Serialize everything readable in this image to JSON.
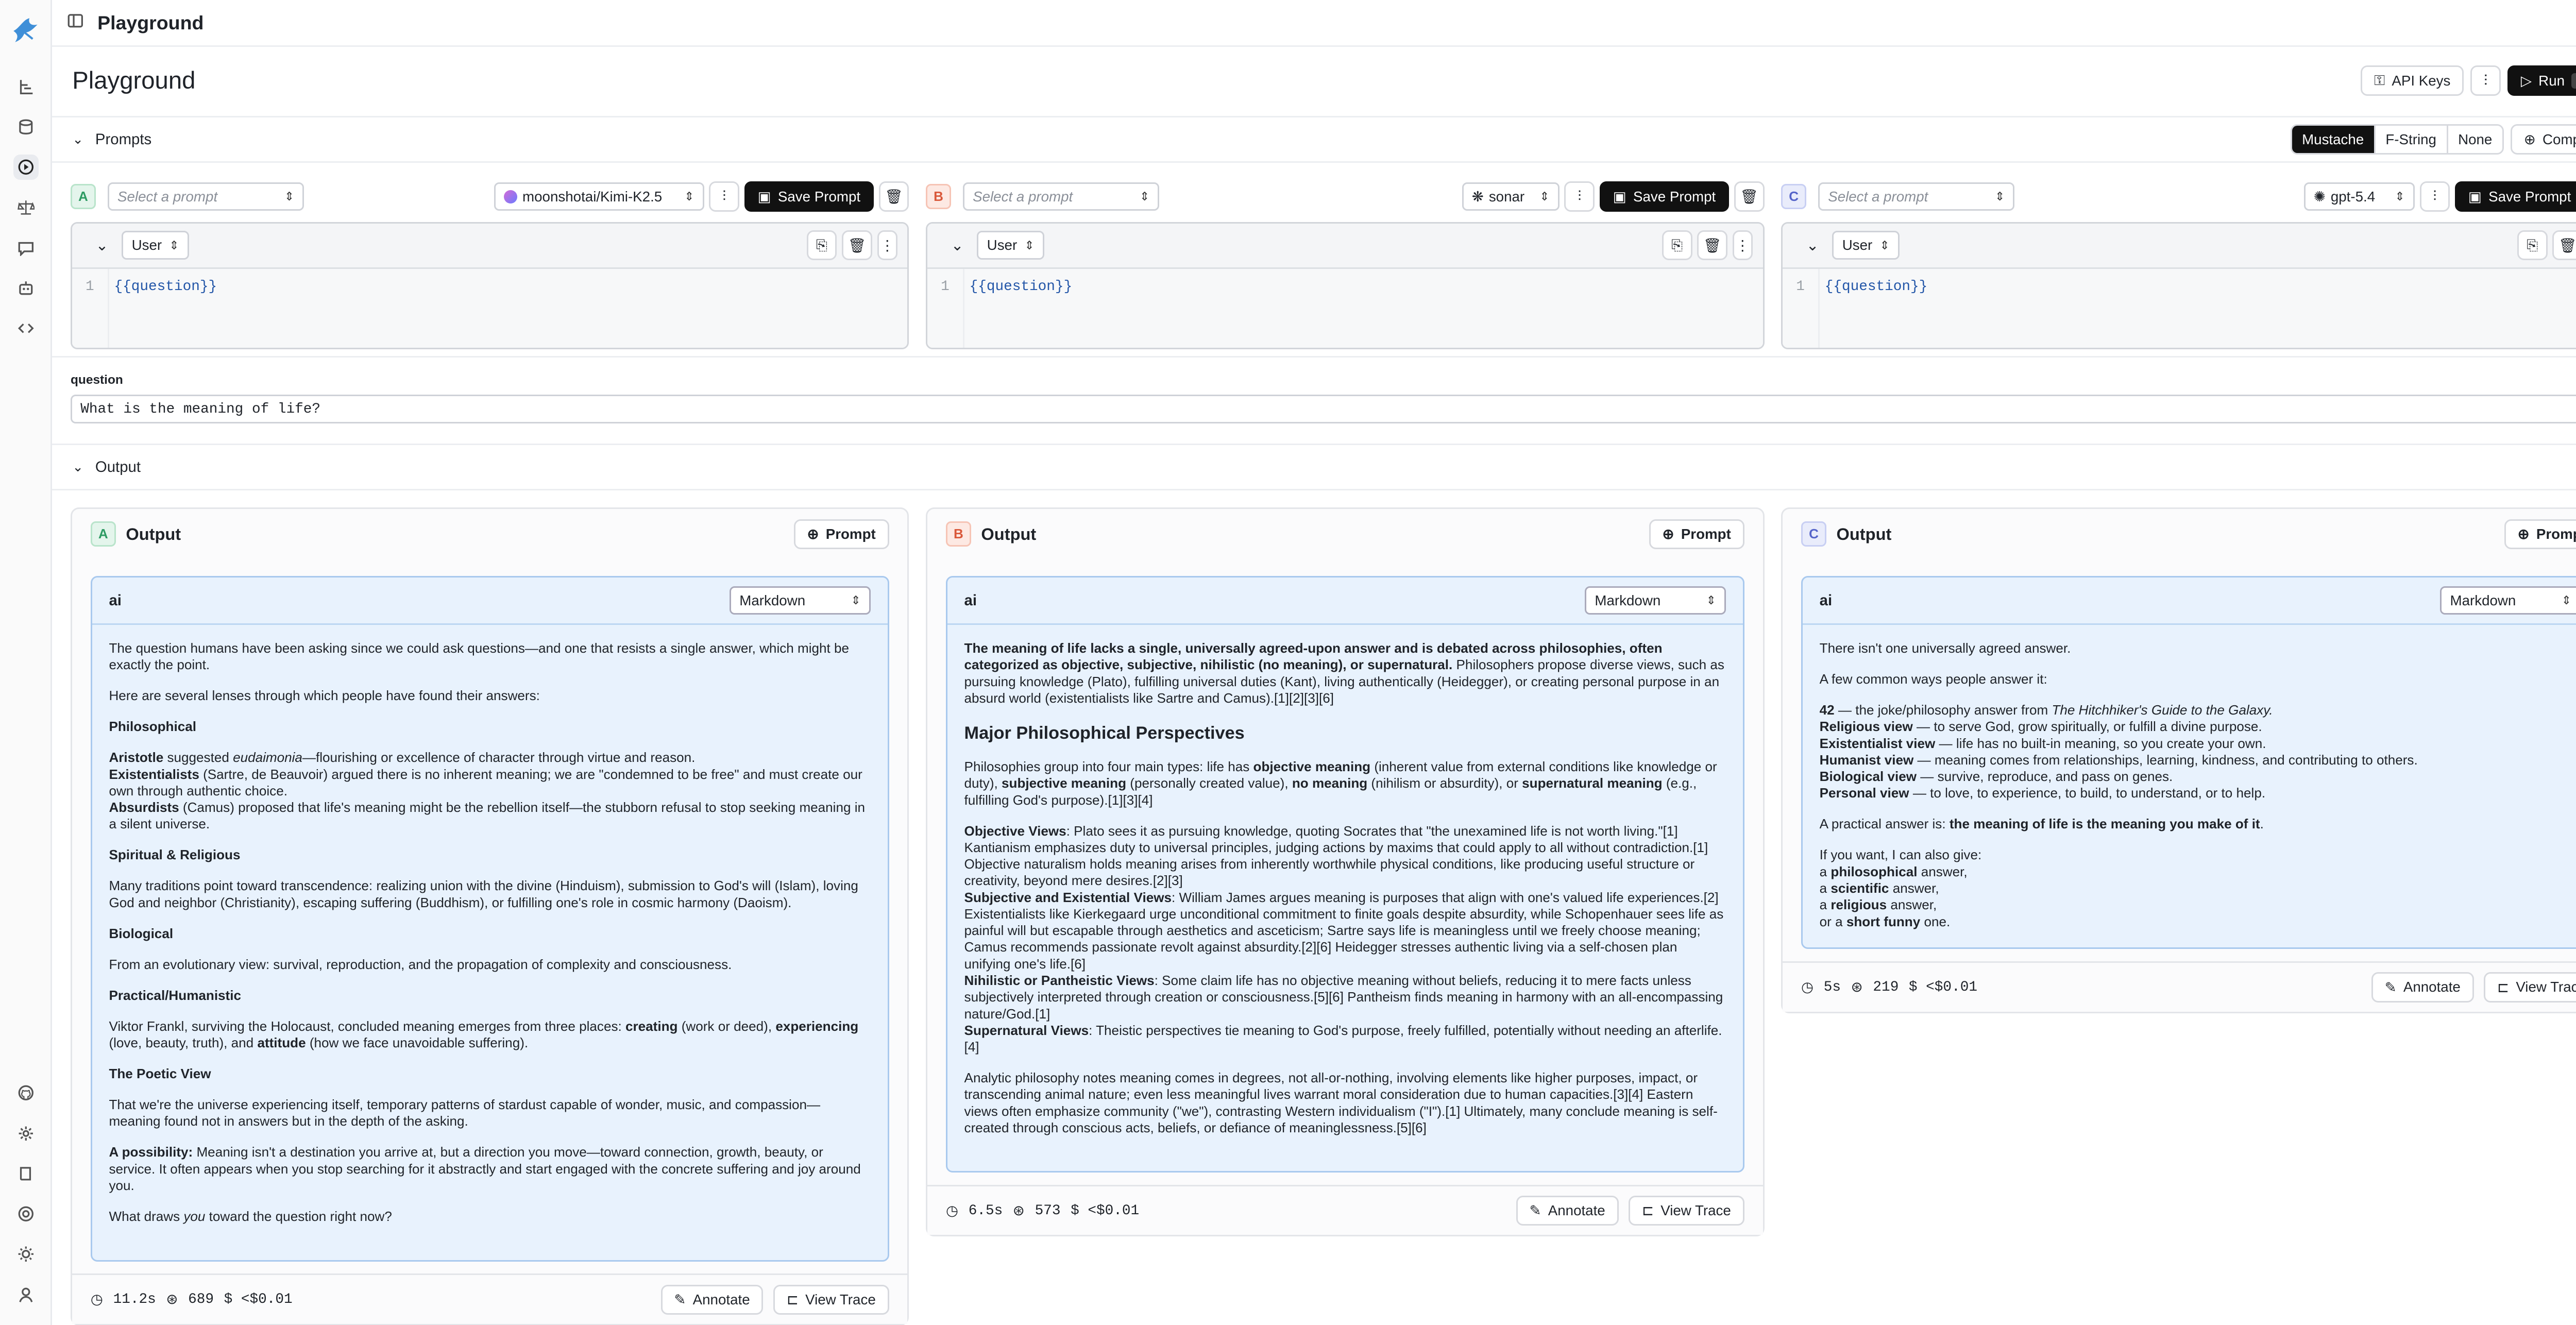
{
  "topbar": {
    "title": "Playground"
  },
  "header": {
    "title": "Playground",
    "api_keys": "API Keys",
    "run": "Run",
    "run_kbd": "⌘⏎"
  },
  "prompts_section": {
    "label": "Prompts",
    "formats": [
      "Mustache",
      "F-String",
      "None"
    ],
    "active_format": "Mustache",
    "compare": "Compare"
  },
  "panels": [
    {
      "letter": "A",
      "select_placeholder": "Select a prompt",
      "model": "moonshotai/Kimi-K2.5",
      "save": "Save Prompt",
      "role": "User",
      "line_no": "1",
      "template": "{{question}}"
    },
    {
      "letter": "B",
      "select_placeholder": "Select a prompt",
      "model": "sonar",
      "save": "Save Prompt",
      "role": "User",
      "line_no": "1",
      "template": "{{question}}"
    },
    {
      "letter": "C",
      "select_placeholder": "Select a prompt",
      "model": "gpt-5.4",
      "save": "Save Prompt",
      "role": "User",
      "line_no": "1",
      "template": "{{question}}"
    }
  ],
  "variables": {
    "label": "question",
    "value": "What is the meaning of life?"
  },
  "output_section": {
    "label": "Output"
  },
  "outputs": [
    {
      "letter": "A",
      "title": "Output",
      "prompt_btn": "Prompt",
      "role": "ai",
      "format": "Markdown",
      "time": "11.2s",
      "tokens": "689",
      "cost": "$ <$0.01",
      "annotate": "Annotate",
      "view_trace": "View Trace"
    },
    {
      "letter": "B",
      "title": "Output",
      "prompt_btn": "Prompt",
      "role": "ai",
      "format": "Markdown",
      "time": "6.5s",
      "tokens": "573",
      "cost": "$ <$0.01",
      "annotate": "Annotate",
      "view_trace": "View Trace"
    },
    {
      "letter": "C",
      "title": "Output",
      "prompt_btn": "Prompt",
      "role": "ai",
      "format": "Markdown",
      "time": "5s",
      "tokens": "219",
      "cost": "$ <$0.01",
      "annotate": "Annotate",
      "view_trace": "View Trace"
    }
  ],
  "text_a": {
    "p1": "The question humans have been asking since we could ask questions—and one that resists a single answer, which might be exactly the point.",
    "p2": "Here are several lenses through which people have found their answers:",
    "h_phil": "Philosophical",
    "aristotle_b": "Aristotle",
    "aristotle_t1": " suggested ",
    "aristotle_i": "eudaimonia",
    "aristotle_t2": "—flourishing or excellence of character through virtue and reason.",
    "exist_b": "Existentialists",
    "exist_t": " (Sartre, de Beauvoir) argued there is no inherent meaning; we are \"condemned to be free\" and must create our own through authentic choice.",
    "absurd_b": "Absurdists",
    "absurd_t": " (Camus) proposed that life's meaning might be the rebellion itself—the stubborn refusal to stop seeking meaning in a silent universe.",
    "h_spirit": "Spiritual & Religious",
    "spirit": "Many traditions point toward transcendence: realizing union with the divine (Hinduism), submission to God's will (Islam), loving God and neighbor (Christianity), escaping suffering (Buddhism), or fulfilling one's role in cosmic harmony (Daoism).",
    "h_bio": "Biological",
    "bio": "From an evolutionary view: survival, reproduction, and the propagation of complexity and consciousness.",
    "h_prac": "Practical/Humanistic",
    "prac1": "Viktor Frankl, surviving the Holocaust, concluded meaning emerges from three places: ",
    "prac_creating": "creating",
    "prac2": " (work or deed), ",
    "prac_experiencing": "experiencing",
    "prac3": " (love, beauty, truth), and ",
    "prac_attitude": "attitude",
    "prac4": " (how we face unavoidable suffering).",
    "h_poetic": "The Poetic View",
    "poetic": "That we're the universe experiencing itself, temporary patterns of stardust capable of wonder, music, and compassion—meaning found not in answers but in the depth of the asking.",
    "poss_b": "A possibility:",
    "poss_t": " Meaning isn't a destination you arrive at, but a direction you move—toward connection, growth, beauty, or service. It often appears when you stop searching for it abstractly and start engaged with the concrete suffering and joy around you.",
    "q1": "What draws ",
    "q_i": "you",
    "q2": " toward the question right now?"
  },
  "text_b": {
    "lead_b": "The meaning of life lacks a single, universally agreed-upon answer and is debated across philosophies, often categorized as objective, subjective, nihilistic (no meaning), or supernatural.",
    "lead_t": " Philosophers propose diverse views, such as pursuing knowledge (Plato), fulfilling universal duties (Kant), living authentically (Heidegger), or creating personal purpose in an absurd world (existentialists like Sartre and Camus).[1][2][3][6]",
    "h_major": "Major Philosophical Perspectives",
    "g1": "Philosophies group into four main types: life has ",
    "g_obj": "objective meaning",
    "g2": " (inherent value from external conditions like knowledge or duty), ",
    "g_subj": "subjective meaning",
    "g3": " (personally created value), ",
    "g_no": "no meaning",
    "g4": " (nihilism or absurdity), or ",
    "g_sup": "supernatural meaning",
    "g5": " (e.g., fulfilling God's purpose).[1][3][4]",
    "obj_b": "Objective Views",
    "obj_t": ": Plato sees it as pursuing knowledge, quoting Socrates that \"the unexamined life is not worth living.\"[1] Kantianism emphasizes duty to universal principles, judging actions by maxims that could apply to all without contradiction.[1] Objective naturalism holds meaning arises from inherently worthwhile physical conditions, like producing useful structure or creativity, beyond mere desires.[2][3]",
    "subj_b": "Subjective and Existential Views",
    "subj_t": ": William James argues meaning is purposes that align with one's valued life experiences.[2] Existentialists like Kierkegaard urge unconditional commitment to finite goals despite absurdity, while Schopenhauer sees life as painful will but escapable through aesthetics and asceticism; Sartre says life is meaningless until we freely choose meaning; Camus recommends passionate revolt against absurdity.[2][6] Heidegger stresses authentic living via a self-chosen plan unifying one's life.[6]",
    "nih_b": "Nihilistic or Pantheistic Views",
    "nih_t": ": Some claim life has no objective meaning without beliefs, reducing it to mere facts unless subjectively interpreted through creation or consciousness.[5][6] Pantheism finds meaning in harmony with an all-encompassing nature/God.[1]",
    "sup_b": "Supernatural Views",
    "sup_t": ": Theistic perspectives tie meaning to God's purpose, freely fulfilled, potentially without needing an afterlife.[4]",
    "analytic": "Analytic philosophy notes meaning comes in degrees, not all-or-nothing, involving elements like higher purposes, impact, or transcending animal nature; even less meaningful lives warrant moral consideration due to human capacities.[3][4] Eastern views often emphasize community (\"we\"), contrasting Western individualism (\"I\").[1] Ultimately, many conclude meaning is self-created through conscious acts, beliefs, or defiance of meaninglessness.[5][6]"
  },
  "text_c": {
    "p1": "There isn't one universally agreed answer.",
    "p2": "A few common ways people answer it:",
    "l1_b": "42",
    "l1_t": " — the joke/philosophy answer from ",
    "l1_i": "The Hitchhiker's Guide to the Galaxy.",
    "l2_b": "Religious view",
    "l2_t": " — to serve God, grow spiritually, or fulfill a divine purpose.",
    "l3_b": "Existentialist view",
    "l3_t": " — life has no built-in meaning, so you create your own.",
    "l4_b": "Humanist view",
    "l4_t": " — meaning comes from relationships, learning, kindness, and contributing to others.",
    "l5_b": "Biological view",
    "l5_t": " — survive, reproduce, and pass on genes.",
    "l6_b": "Personal view",
    "l6_t": " — to love, to experience, to build, to understand, or to help.",
    "pr1": "A practical answer is: ",
    "pr_b": "the meaning of life is the meaning you make of it",
    "pr2": ".",
    "give": "If you want, I can also give:",
    "g1a": "a ",
    "g1b": "philosophical",
    "g1c": " answer,",
    "g2a": "a ",
    "g2b": "scientific",
    "g2c": " answer,",
    "g3a": "a ",
    "g3b": "religious",
    "g3c": " answer,",
    "g4a": "or a ",
    "g4b": "short funny",
    "g4c": " one."
  }
}
